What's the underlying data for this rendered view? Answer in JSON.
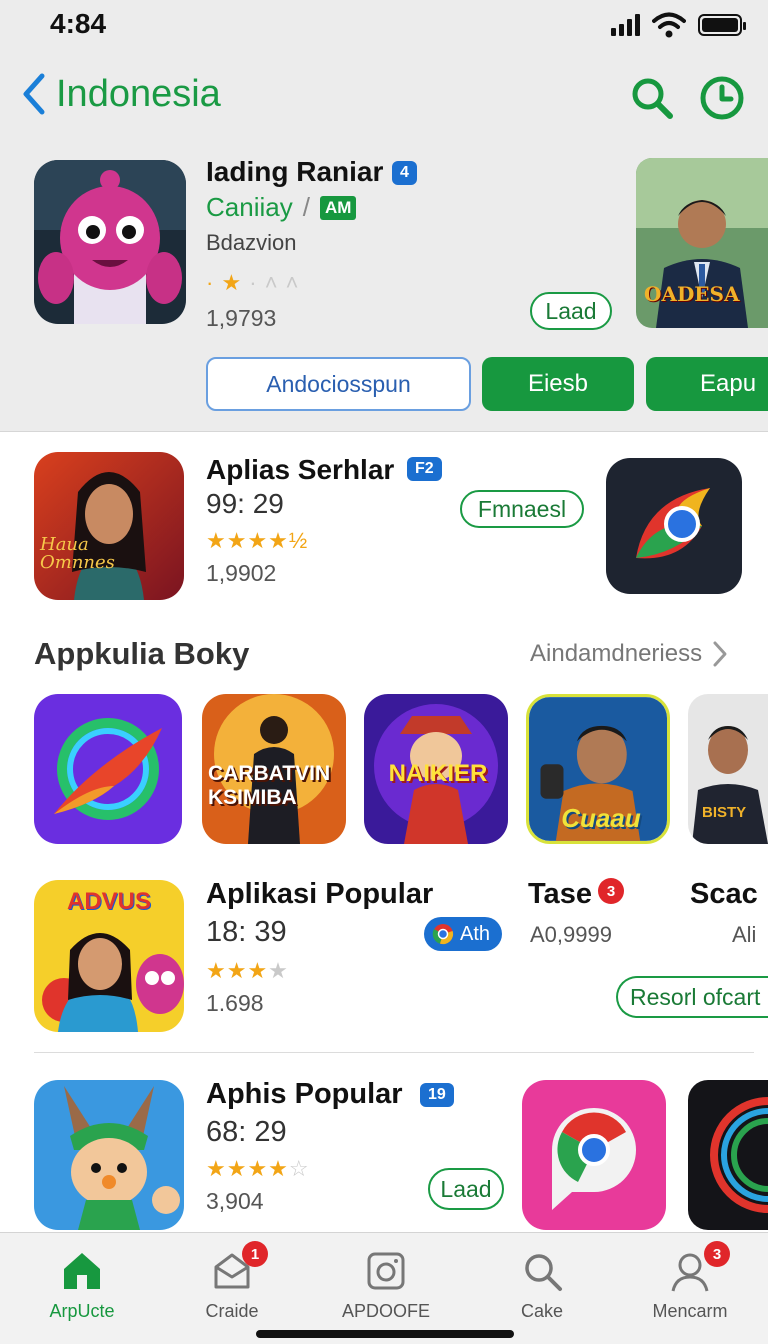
{
  "status_bar": {
    "time": "4:84"
  },
  "header": {
    "back_title": "Indonesia",
    "search_icon": "search-icon",
    "history_icon": "clock-icon"
  },
  "featured": {
    "title": "Iading Raniar",
    "badge": "4",
    "developer": "Caniiay",
    "developer_tag": "AM",
    "category": "Bdazvion",
    "rating_count": "1,9793",
    "get_label": "Laad",
    "side_card_text": "OADESA",
    "buttons": [
      "Andociosspun",
      "Eiesb",
      "Eapu"
    ]
  },
  "row1": {
    "title": "Aplias Serhlar",
    "badge": "F2",
    "price": "99: 29",
    "rating_count": "1,9902",
    "action_label": "Fmnaesl",
    "icon_caption": "Haua Omnnes",
    "rating": 4.5
  },
  "section": {
    "title": "Appkulia Boky",
    "see_all": "Aindamdneriess"
  },
  "carousel": [
    {
      "name": "swirl-app",
      "caption": ""
    },
    {
      "name": "carbatvin",
      "caption": "CARBATVIN KSIMIBA"
    },
    {
      "name": "naikier",
      "caption": "NAIKIER"
    },
    {
      "name": "cuaau",
      "caption": "Cuaau"
    },
    {
      "name": "bisty",
      "caption": "BISTY"
    }
  ],
  "row2": {
    "title": "Aplikasi Popular",
    "price": "18: 39",
    "badge": "Ath",
    "rating_count": "1.698",
    "rating": 3.5,
    "icon_caption": "ADVUS",
    "side_title": "Tase",
    "side_badge": "3",
    "side_value": "A0,9999",
    "side2_title": "Scac",
    "side2_value": "Ali",
    "action_label": "Resorl ofcart"
  },
  "row3": {
    "title": "Aphis Popular",
    "badge": "19",
    "price": "68: 29",
    "rating": 4.0,
    "rating_count": "3,904",
    "get_label": "Laad"
  },
  "tabs": [
    {
      "label": "ArpUcte",
      "icon": "home-icon",
      "active": true,
      "badge": ""
    },
    {
      "label": "Craide",
      "icon": "inbox-icon",
      "active": false,
      "badge": "1"
    },
    {
      "label": "APDOOFE",
      "icon": "camera-icon",
      "active": false,
      "badge": ""
    },
    {
      "label": "Cake",
      "icon": "search-icon",
      "active": false,
      "badge": ""
    },
    {
      "label": "Mencarm",
      "icon": "user-icon",
      "active": false,
      "badge": "3"
    }
  ],
  "colors": {
    "accent_green": "#17983f",
    "link_blue": "#1b6fd0",
    "badge_red": "#e0262a",
    "star": "#f2a516"
  }
}
